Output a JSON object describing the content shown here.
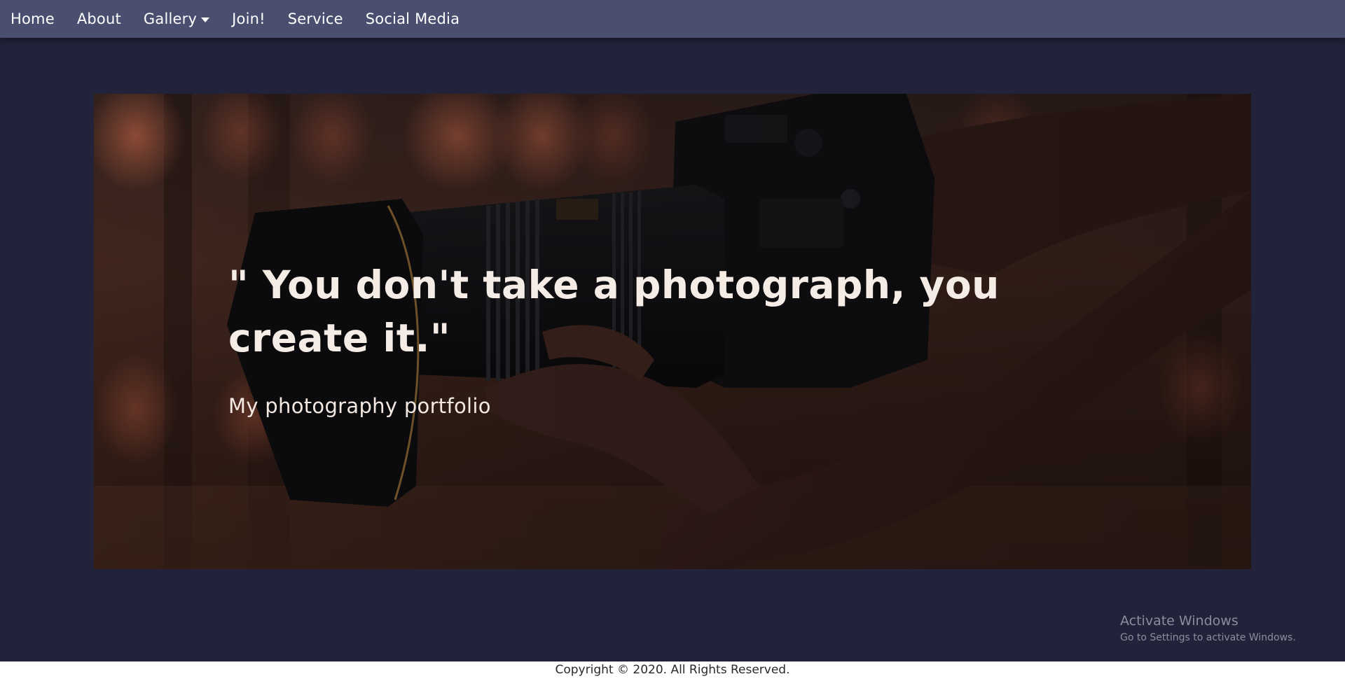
{
  "nav": {
    "items": [
      {
        "label": "Home"
      },
      {
        "label": "About"
      },
      {
        "label": "Gallery",
        "has_dropdown": true
      },
      {
        "label": "Join!"
      },
      {
        "label": "Service"
      },
      {
        "label": "Social Media"
      }
    ]
  },
  "hero": {
    "quote": "\" You don't take a photograph, you create it.\"",
    "subtitle": "My photography portfolio",
    "image_description": "hands holding a DSLR camera with a large lens"
  },
  "watermark": {
    "title": "Activate Windows",
    "subtitle": "Go to Settings to activate Windows."
  },
  "footer": {
    "copyright": "Copyright © 2020. All Rights Reserved."
  },
  "colors": {
    "page_background": "#23223b",
    "navbar": "#4b4f6f",
    "hero_text": "#f6ece6",
    "footer_background": "#ffffff"
  }
}
